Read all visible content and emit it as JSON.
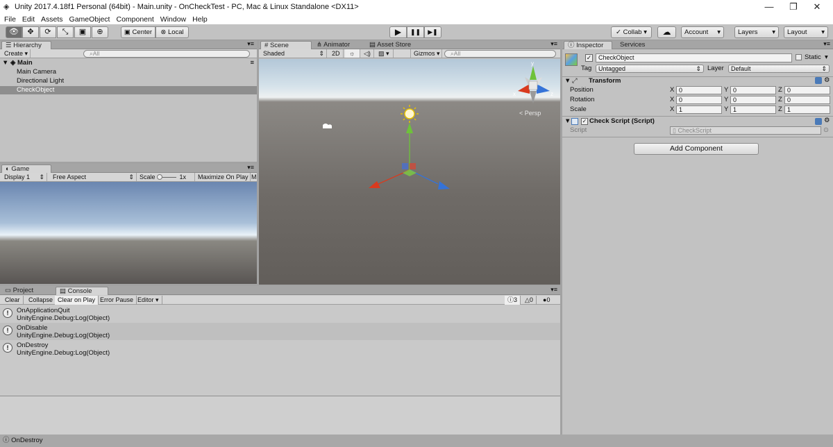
{
  "window": {
    "title": "Unity 2017.4.18f1 Personal (64bit) - Main.unity - OnCheckTest - PC, Mac & Linux Standalone <DX11>",
    "controls": [
      "—",
      "❐",
      "✕"
    ]
  },
  "menu": [
    "File",
    "Edit",
    "Assets",
    "GameObject",
    "Component",
    "Window",
    "Help"
  ],
  "toolbar": {
    "tools": [
      "hand-tool",
      "move-tool",
      "rotate-tool",
      "scale-tool",
      "rect-tool",
      "transform-tool"
    ],
    "tool_glyphs": [
      "👁",
      "✥",
      "⟳",
      "⤡",
      "▣",
      "⊕"
    ],
    "pivot": "Center",
    "space": "Local",
    "play": "▶",
    "pause": "❚❚",
    "step": "▶❚",
    "collab": "Collab ▾",
    "cloud": "☁",
    "account": "Account",
    "layers": "Layers",
    "layout": "Layout"
  },
  "hierarchy": {
    "tab": "Hierarchy",
    "create": "Create ▾",
    "search_placeholder": "All",
    "scene": "Main",
    "items": [
      "Main Camera",
      "Directional Light",
      "CheckObject"
    ],
    "selected_index": 2
  },
  "game": {
    "tab": "Game",
    "display": "Display 1",
    "aspect": "Free Aspect",
    "scale_label": "Scale",
    "scale_value": "1x",
    "maximize": "Maximize On Play",
    "extra": "M"
  },
  "scene": {
    "tabs": [
      "Scene",
      "Animator",
      "Asset Store"
    ],
    "shading": "Shaded",
    "mode2d": "2D",
    "gizmos": "Gizmos",
    "search_placeholder": "All",
    "persp": "< Persp"
  },
  "console": {
    "tabs": [
      "Project",
      "Console"
    ],
    "buttons": [
      "Clear",
      "Collapse",
      "Clear on Play",
      "Error Pause",
      "Editor"
    ],
    "counts": {
      "logs": "3",
      "warnings": "0",
      "errors": "0"
    },
    "entries": [
      {
        "line1": "OnApplicationQuit",
        "line2": "UnityEngine.Debug:Log(Object)"
      },
      {
        "line1": "OnDisable",
        "line2": "UnityEngine.Debug:Log(Object)"
      },
      {
        "line1": "OnDestroy",
        "line2": "UnityEngine.Debug:Log(Object)"
      }
    ]
  },
  "inspector": {
    "tabs": [
      "Inspector",
      "Services"
    ],
    "object_name": "CheckObject",
    "static_label": "Static",
    "tag_label": "Tag",
    "tag_value": "Untagged",
    "layer_label": "Layer",
    "layer_value": "Default",
    "transform": {
      "title": "Transform",
      "rows": [
        {
          "label": "Position",
          "x": "0",
          "y": "0",
          "z": "0"
        },
        {
          "label": "Rotation",
          "x": "0",
          "y": "0",
          "z": "0"
        },
        {
          "label": "Scale",
          "x": "1",
          "y": "1",
          "z": "1"
        }
      ]
    },
    "script_component": {
      "title": "Check Script (Script)",
      "script_label": "Script",
      "script_value": "CheckScript"
    },
    "add_component": "Add Component"
  },
  "status": {
    "message": "OnDestroy"
  }
}
